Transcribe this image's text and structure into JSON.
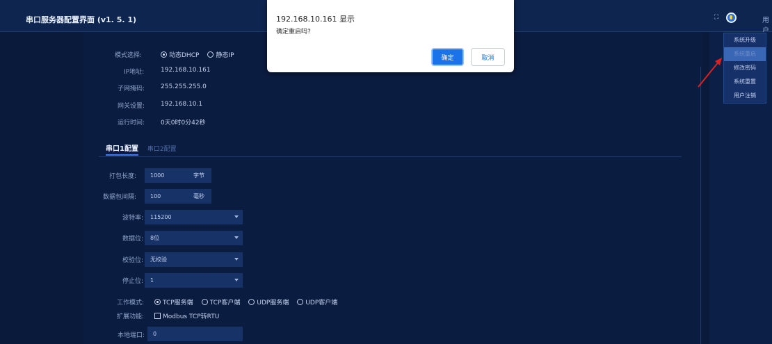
{
  "header": {
    "title": "串口服务器配置界面 (v1. 5. 1)",
    "expand_icon": "expand-icon",
    "user_label": "用户"
  },
  "menu": {
    "items": [
      "系统升级",
      "系统重启",
      "修改密码",
      "系统重置",
      "用户注销"
    ],
    "hovered_index": 1
  },
  "network": {
    "mode_label": "模式选择:",
    "mode_options": [
      "动态DHCP",
      "静态IP"
    ],
    "mode_selected": 0,
    "ip_label": "IP地址:",
    "ip_value": "192.168.10.161",
    "mask_label": "子网掩码:",
    "mask_value": "255.255.255.0",
    "gateway_label": "网关设置:",
    "gateway_value": "192.168.10.1",
    "uptime_label": "运行时间:",
    "uptime_value": "0天0时0分42秒"
  },
  "tabs": [
    "串口1配置",
    "串口2配置"
  ],
  "serial": {
    "pack_len_label": "打包长度:",
    "pack_len_value": "1000",
    "pack_len_unit": "字节",
    "interval_label": "数据包间隔:",
    "interval_value": "100",
    "interval_unit": "毫秒",
    "baud_label": "波特率:",
    "baud_value": "115200",
    "databits_label": "数据位:",
    "databits_value": "8位",
    "parity_label": "校验位:",
    "parity_value": "无校验",
    "stopbits_label": "停止位:",
    "stopbits_value": "1",
    "work_mode_label": "工作模式:",
    "work_mode_options": [
      "TCP服务端",
      "TCP客户端",
      "UDP服务端",
      "UDP客户端"
    ],
    "work_mode_selected": 0,
    "ext_label": "扩展功能:",
    "ext_option": "Modbus TCP转RTU",
    "local_port_label": "本地端口:",
    "local_port_value": "0"
  },
  "dialog": {
    "title": "192.168.10.161 显示",
    "message": "确定重启吗?",
    "ok_label": "确定",
    "cancel_label": "取消"
  },
  "colors": {
    "accent": "#1a73e8",
    "background": "#0a1a3a",
    "arrow": "#e02020"
  }
}
